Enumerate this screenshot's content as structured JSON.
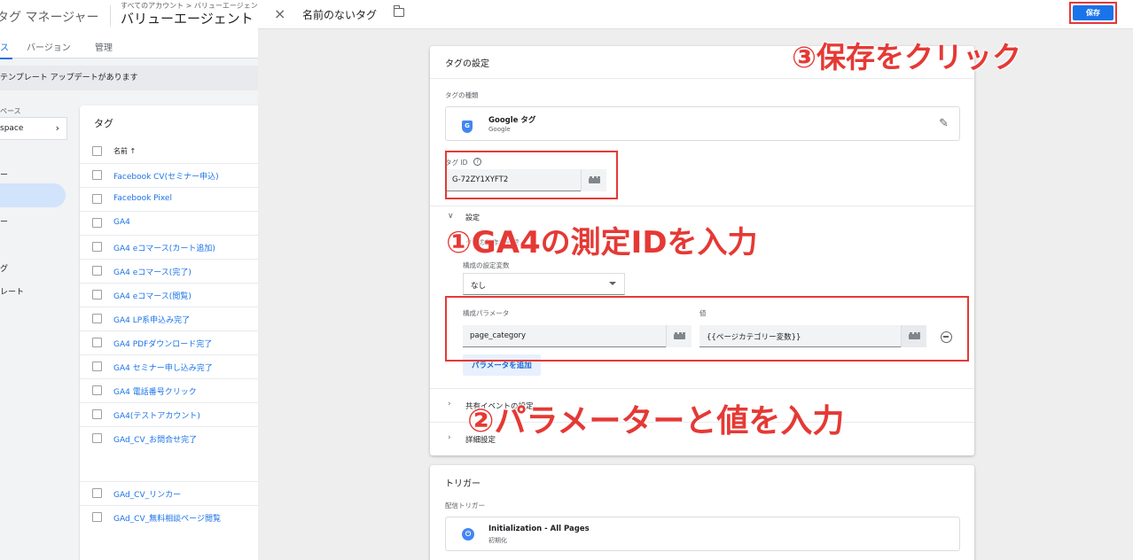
{
  "app": {
    "title": "タグ マネージャー",
    "breadcrumb": "すべてのアカウント > バリューエージェン",
    "container": "バリューエージェント"
  },
  "nav": {
    "tabs": [
      "ス",
      "バージョン",
      "管理"
    ]
  },
  "notice": "テンプレート アップデートがあります",
  "workspace": {
    "label": "ペース",
    "value": "space"
  },
  "sidebar": {
    "items": [
      "ー",
      "",
      "ー",
      "",
      "グ",
      "レート"
    ]
  },
  "tag_list": {
    "title": "タグ",
    "name_header": "名前 ↑",
    "rows": [
      "Facebook CV(セミナー申込)",
      "Facebook Pixel",
      "GA4",
      "GA4 eコマース(カート追加)",
      "GA4 eコマース(完了)",
      "GA4 eコマース(閲覧)",
      "GA4 LP系申込み完了",
      "GA4 PDFダウンロード完了",
      "GA4 セミナー申し込み完了",
      "GA4 電話番号クリック",
      "GA4(テストアカウント)",
      "GAd_CV_お問合せ完了",
      "GAd_CV_リンカー",
      "GAd_CV_無料相談ページ閲覧"
    ]
  },
  "dialog": {
    "close_icon": "×",
    "title": "名前のないタグ",
    "save_label": "保存",
    "more_icon": "⋮",
    "tag_config": {
      "title": "タグの設定",
      "type_label": "タグの種類",
      "type_icon": "G",
      "type_name": "Google タグ",
      "type_sub": "Google",
      "tag_id_label": "タグ ID",
      "tag_id_help": "?",
      "tag_id_value": "G-72ZY1XYFT2",
      "settings_label": "設定",
      "settings_desc": "タグの動作を管理",
      "config_var_label": "構成の設定変数",
      "config_var_value": "なし",
      "param_label": "構成パラメータ",
      "value_label": "値",
      "param_value": "page_category",
      "value_value": "{{ページカテゴリー変数}}",
      "add_param": "パラメータを追加",
      "shared_event": "共有イベントの設定",
      "advanced": "詳細設定"
    },
    "trigger": {
      "title": "トリガー",
      "fire_label": "配信トリガー",
      "icon": "⏻",
      "name": "Initialization - All Pages",
      "sub": "初期化"
    }
  },
  "annotations": {
    "step1": "①GA4の測定IDを入力",
    "step2": "②パラメーターと値を入力",
    "step3": "③保存をクリック",
    "color": "#e53935"
  }
}
